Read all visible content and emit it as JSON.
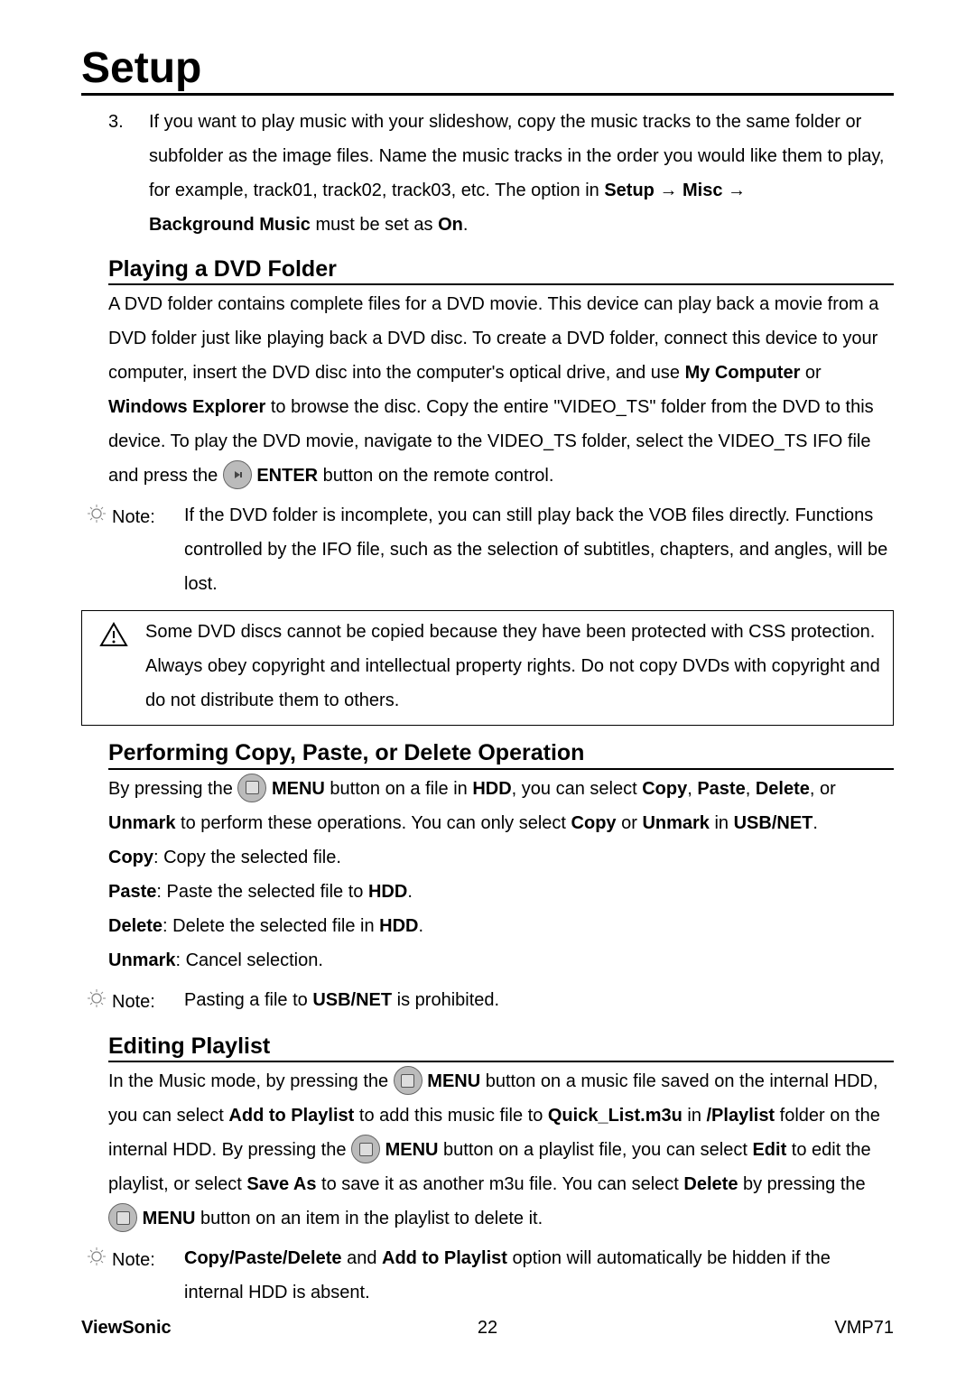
{
  "title": "Setup",
  "step3_num": "3.",
  "step3_pre": "If you want to play music with your slideshow, copy the music tracks to the same folder or subfolder as the image files. Name the music tracks in the order you would like them to play, for example, track01, track02, track03, etc. The option in ",
  "step3_b1": "Setup",
  "step3_arrow": " → ",
  "step3_b2": "Misc",
  "step3_line2a": "Background Music",
  "step3_line2b": " must be set as ",
  "step3_line2c": "On",
  "step3_line2d": ".",
  "h_dvd": "Playing a DVD Folder",
  "dvd_p1a": "A DVD folder contains complete files for a DVD movie. This device can play back a movie from a DVD folder just like playing back a DVD disc. To create a DVD folder, connect this device to your computer, insert the DVD disc into the computer's optical drive, and use ",
  "dvd_b1": "My Computer",
  "dvd_p1b": " or ",
  "dvd_b2": "Windows Explorer",
  "dvd_p1c": " to browse the disc. Copy the entire \"VIDEO_TS\" folder from the DVD to this device. To play the DVD movie, navigate to the VIDEO_TS folder, select the VIDEO_TS IFO file and press the ",
  "dvd_b3": "ENTER",
  "dvd_p1d": " button on the remote control.",
  "note_label": "Note:",
  "dvd_note": "If the DVD folder is incomplete, you can still play back the VOB files directly. Functions controlled by the IFO file, such as the selection of subtitles, chapters, and angles, will be lost.",
  "warn": "Some DVD discs cannot be copied because they have been protected with CSS protection. Always obey copyright and intellectual property rights. Do not copy DVDs with copyright and do not distribute them to others.",
  "h_copy": "Performing Copy, Paste, or Delete Operation",
  "copy_p1a": "By pressing the ",
  "copy_b_menu": "MENU",
  "copy_p1b": " button on a file in ",
  "copy_b_hdd": "HDD",
  "copy_p1c": ", you can select ",
  "copy_b_copy": "Copy",
  "copy_comma": ", ",
  "copy_b_paste": "Paste",
  "copy_b_delete": "Delete",
  "copy_or": ", or ",
  "copy_b_unmark": "Unmark",
  "copy_p1d": " to perform these operations. You can only select ",
  "copy_p1e": " or ",
  "copy_p1f": " in ",
  "copy_b_usbnet": "USB/NET",
  "copy_dot": ".",
  "copy_l1a": "Copy",
  "copy_l1b": ": Copy the selected file.",
  "copy_l2a": "Paste",
  "copy_l2b": ": Paste the selected file to ",
  "copy_l2c": "HDD",
  "copy_l2d": ".",
  "copy_l3a": "Delete",
  "copy_l3b": ": Delete the selected file in ",
  "copy_l3c": "HDD",
  "copy_l3d": ".",
  "copy_l4a": "Unmark",
  "copy_l4b": ": Cancel selection.",
  "copy_note_a": "Pasting a file to ",
  "copy_note_b": "USB/NET",
  "copy_note_c": " is prohibited.",
  "h_edit": "Editing Playlist",
  "edit_a": "In the Music mode, by pressing the ",
  "edit_b": " button on a music file saved on the internal HDD, you can select ",
  "edit_b_add": "Add to Playlist",
  "edit_c": " to add this music file to ",
  "edit_b_ql": "Quick_List.m3u",
  "edit_d": " in ",
  "edit_b_pl": "/Playlist",
  "edit_e": " folder on the internal HDD. By pressing the ",
  "edit_f": " button on a playlist file, you can select ",
  "edit_b_edit": "Edit",
  "edit_g": " to edit the playlist, or select ",
  "edit_b_save": "Save As",
  "edit_h": " to save it as another m3u file. You can select ",
  "edit_b_del": "Delete",
  "edit_i": " by pressing the ",
  "edit_j": " button on an item in the playlist to delete it.",
  "edit_note_a": "Copy/Paste/Delete",
  "edit_note_b": " and ",
  "edit_note_c": "Add to Playlist",
  "edit_note_d": " option will automatically be hidden if the internal HDD is absent.",
  "footer_left": "ViewSonic",
  "footer_center": "22",
  "footer_right": "VMP71"
}
